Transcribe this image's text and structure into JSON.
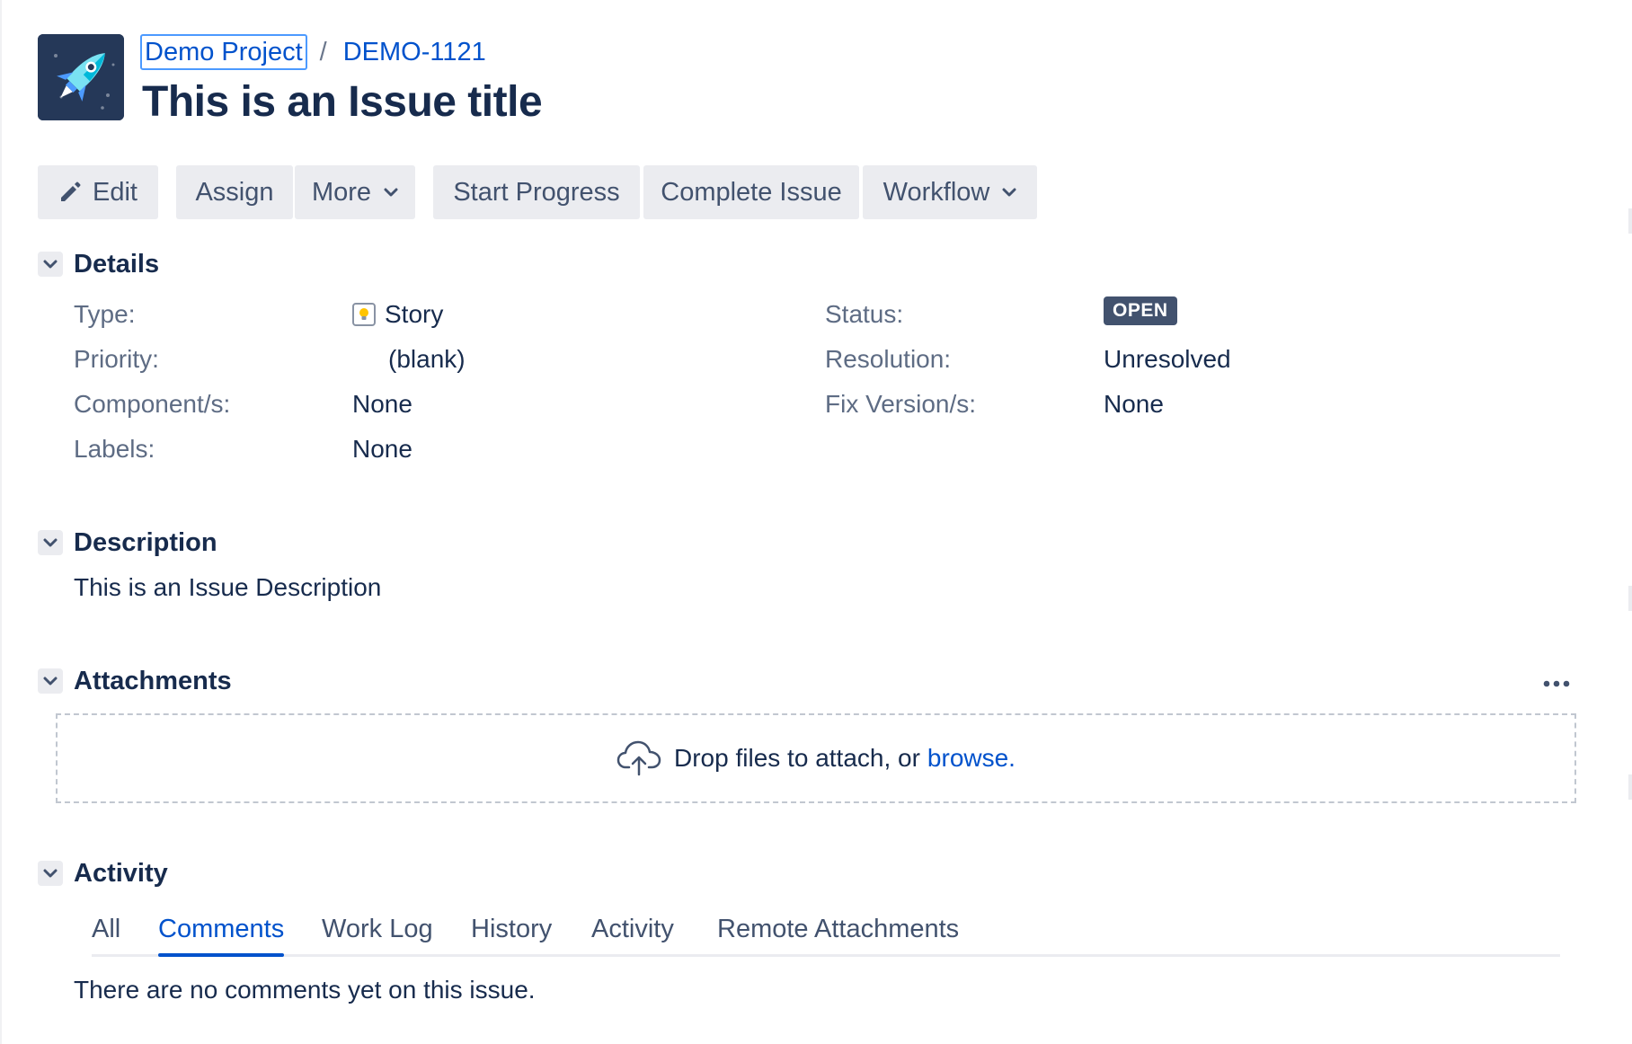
{
  "breadcrumb": {
    "project": "Demo Project",
    "separator": "/",
    "issue_key": "DEMO-1121"
  },
  "issue": {
    "title": "This is an Issue title"
  },
  "toolbar": {
    "edit_label": "Edit",
    "assign_label": "Assign",
    "more_label": "More",
    "start_progress_label": "Start Progress",
    "complete_issue_label": "Complete Issue",
    "workflow_label": "Workflow"
  },
  "details": {
    "title": "Details",
    "type_label": "Type:",
    "type_value": "Story",
    "priority_label": "Priority:",
    "priority_value": "(blank)",
    "components_label": "Component/s:",
    "components_value": "None",
    "labels_label": "Labels:",
    "labels_value": "None",
    "status_label": "Status:",
    "status_value": "OPEN",
    "resolution_label": "Resolution:",
    "resolution_value": "Unresolved",
    "fix_versions_label": "Fix Version/s:",
    "fix_versions_value": "None"
  },
  "description": {
    "title": "Description",
    "text": "This is an Issue Description"
  },
  "attachments": {
    "title": "Attachments",
    "drop_text": "Drop files to attach, or",
    "browse_text": "browse."
  },
  "activity": {
    "title": "Activity",
    "tabs": [
      {
        "label": "All",
        "active": false
      },
      {
        "label": "Comments",
        "active": true
      },
      {
        "label": "Work Log",
        "active": false
      },
      {
        "label": "History",
        "active": false
      },
      {
        "label": "Activity",
        "active": false
      },
      {
        "label": "Remote Attachments",
        "active": false
      }
    ],
    "empty_text": "There are no comments yet on this issue."
  },
  "icons": {
    "project_avatar": "rocket-icon",
    "edit": "pencil-icon",
    "dropdown": "chevron-down-icon",
    "section_toggle": "chevron-down-icon",
    "issue_type": "lightbulb-icon",
    "attachments_menu": "more-horizontal-icon",
    "upload": "cloud-upload-icon"
  },
  "colors": {
    "link": "#0052cc",
    "text": "#172b4d",
    "muted": "#5e6c84",
    "button_bg": "#ebecf0",
    "status_lozenge": "#42526e",
    "avatar_bg": "#253858"
  }
}
